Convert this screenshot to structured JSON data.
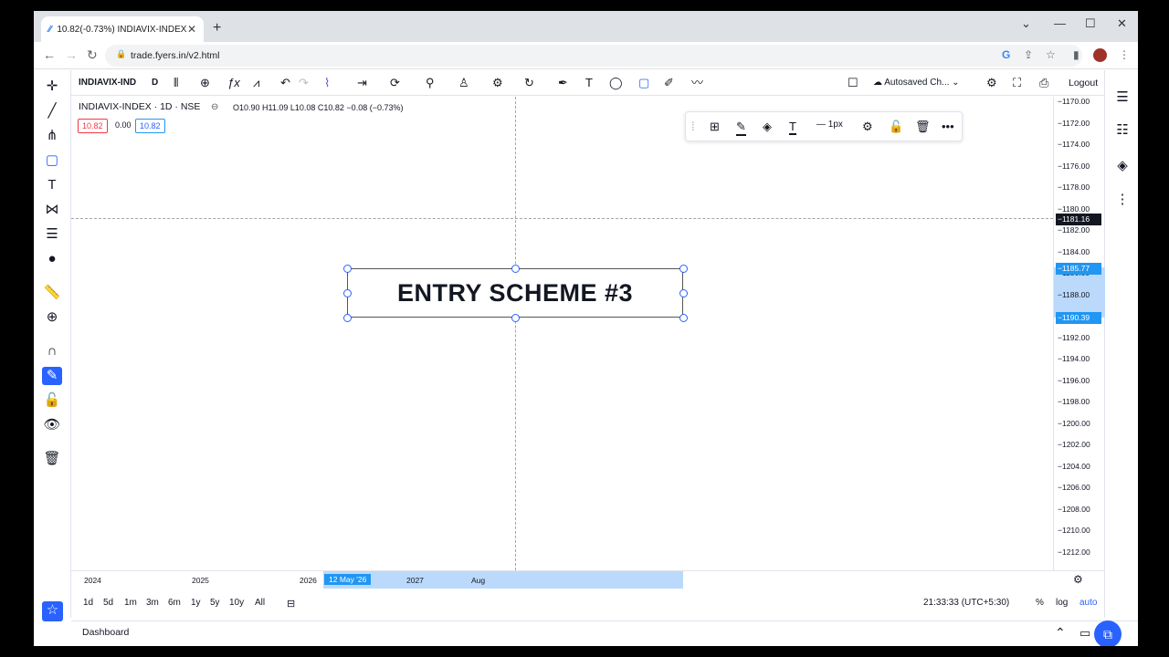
{
  "browser": {
    "tab_title": "10.82(-0.73%) INDIAVIX-INDEX",
    "tab_icon": "⁄⁄",
    "url": "trade.fyers.in/v2.html"
  },
  "toolbar": {
    "symbol": "INDIAVIX-IND",
    "interval": "D",
    "autosave": "Autosaved Ch...",
    "logout": "Logout"
  },
  "legend": {
    "title": "INDIAVIX-INDEX · 1D · NSE",
    "ohlc": "O10.90 H11.09 L10.08 C10.82 −0.08 (−0.73%)",
    "bid": "10.82",
    "spread": "0.00",
    "ask": "10.82"
  },
  "draw_toolbar": {
    "width_label": "1px"
  },
  "textbox": {
    "text": "ENTRY SCHEME #3"
  },
  "price_axis": {
    "ticks": [
      "−1170.00",
      "−1172.00",
      "−1174.00",
      "−1176.00",
      "−1178.00",
      "−1180.00",
      "−1182.00",
      "−1184.00",
      "−1186.00",
      "−1188.00",
      "−1190.00",
      "−1192.00",
      "−1194.00",
      "−1196.00",
      "−1198.00",
      "−1200.00",
      "−1202.00",
      "−1204.00",
      "−1206.00",
      "−1208.00",
      "−1210.00",
      "−1212.00"
    ],
    "crosshair_label": "−1181.16",
    "top_label": "−1185.77",
    "bottom_label": "−1190.39"
  },
  "time_axis": {
    "labels": [
      "2024",
      "2025",
      "2026",
      "12 May '26",
      "2027",
      "Aug"
    ]
  },
  "bottom": {
    "ranges": [
      "1d",
      "5d",
      "1m",
      "3m",
      "6m",
      "1y",
      "5y",
      "10y",
      "All"
    ],
    "clock": "21:33:33 (UTC+5:30)",
    "percent": "%",
    "log": "log",
    "auto": "auto"
  },
  "footer": {
    "dashboard": "Dashboard"
  },
  "colors": {
    "accent": "#2962ff",
    "highlight": "#bbd9fb",
    "crosshair_label": "#131722"
  }
}
